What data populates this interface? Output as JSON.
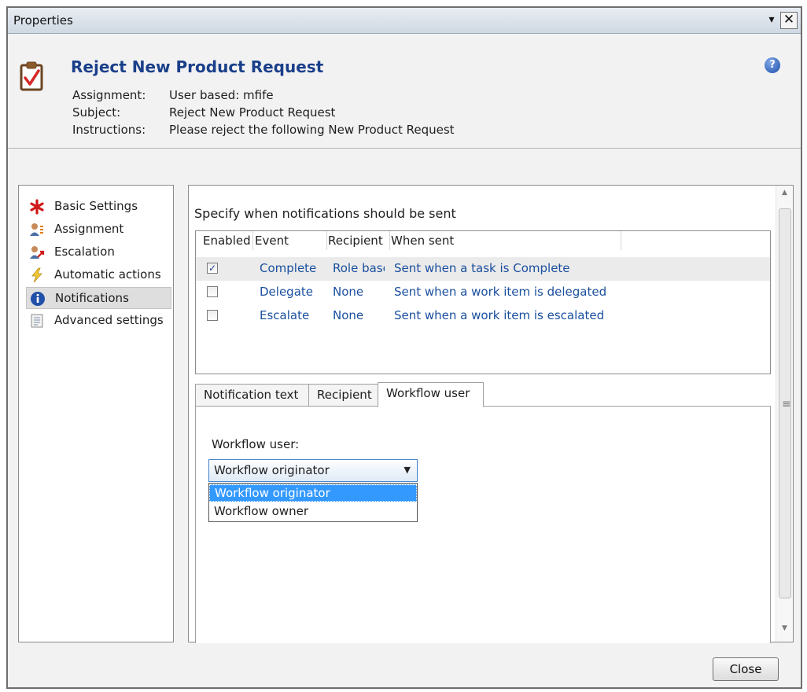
{
  "window": {
    "title": "Properties",
    "menu_glyph": "▾",
    "close_glyph": "✕"
  },
  "header": {
    "title": "Reject New Product Request",
    "help_glyph": "?",
    "fields": [
      {
        "label": "Assignment:",
        "value": "User based: mfife"
      },
      {
        "label": "Subject:",
        "value": "Reject New Product Request"
      },
      {
        "label": "Instructions:",
        "value": "Please reject the following New Product Request"
      }
    ]
  },
  "sidebar": {
    "items": [
      {
        "label": "Basic Settings",
        "icon": "asterisk-icon",
        "selected": false
      },
      {
        "label": "Assignment",
        "icon": "users-icon",
        "selected": false
      },
      {
        "label": "Escalation",
        "icon": "escalation-icon",
        "selected": false
      },
      {
        "label": "Automatic actions",
        "icon": "lightning-icon",
        "selected": false
      },
      {
        "label": "Notifications",
        "icon": "info-icon",
        "selected": true
      },
      {
        "label": "Advanced settings",
        "icon": "settings-document-icon",
        "selected": false
      }
    ]
  },
  "notifications": {
    "section_label": "Specify when notifications should be sent",
    "columns": [
      "Enabled",
      "Event",
      "Recipient",
      "When sent"
    ],
    "rows": [
      {
        "enabled": true,
        "event": "Complete",
        "recipient": "Role based",
        "when_sent": "Sent when a task is Complete"
      },
      {
        "enabled": false,
        "event": "Delegate",
        "recipient": "None",
        "when_sent": "Sent when a work item is delegated"
      },
      {
        "enabled": false,
        "event": "Escalate",
        "recipient": "None",
        "when_sent": "Sent when a work item is escalated"
      }
    ],
    "check_glyph": "✓"
  },
  "tabs": [
    {
      "label": "Notification text",
      "active": false
    },
    {
      "label": "Recipient",
      "active": false
    },
    {
      "label": "Workflow user",
      "active": true
    }
  ],
  "workflow_user": {
    "label": "Workflow user:",
    "selected": "Workflow originator",
    "options": [
      "Workflow originator",
      "Workflow owner"
    ],
    "caret_glyph": "▼"
  },
  "scrollbar": {
    "up_glyph": "▲",
    "down_glyph": "▼",
    "grip_glyph": "≡"
  },
  "footer": {
    "close_label": "Close"
  },
  "colors": {
    "accent": "#1a3f8a",
    "link": "#1a4f9e",
    "highlight": "#3399ff"
  }
}
